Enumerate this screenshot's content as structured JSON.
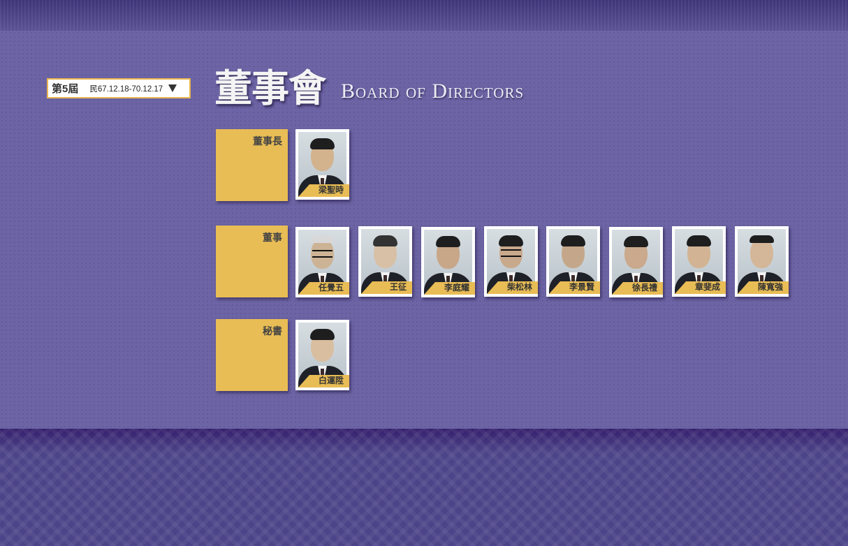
{
  "term_selector": {
    "label": "第5屆",
    "dates": "民67.12.18-70.12.17"
  },
  "title": {
    "chinese": "董事會",
    "english": "Board of Directors"
  },
  "groups": [
    {
      "role": "董事長",
      "members": [
        "梁聖時"
      ]
    },
    {
      "role": "董事",
      "members": [
        "任覺五",
        "王征",
        "李庭耀",
        "柴松林",
        "李景賢",
        "徐長禮",
        "章斐成",
        "陳寬強"
      ]
    },
    {
      "role": "秘書",
      "members": [
        "白運陞"
      ]
    }
  ],
  "colors": {
    "accent_gold": "#e9bd55",
    "panel_purple": "#6c64a4"
  }
}
